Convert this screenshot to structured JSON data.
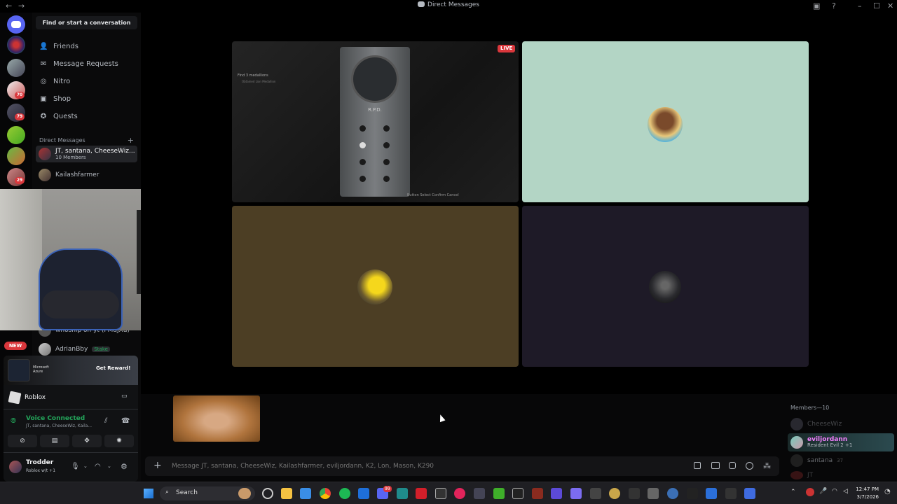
{
  "window": {
    "title": "Direct Messages"
  },
  "sidebar": {
    "search_label": "Find or start a conversation",
    "nav": [
      {
        "label": "Friends",
        "icon": "friends-icon"
      },
      {
        "label": "Message Requests",
        "icon": "mail-icon"
      },
      {
        "label": "Nitro",
        "icon": "nitro-icon"
      },
      {
        "label": "Shop",
        "icon": "shop-icon"
      },
      {
        "label": "Quests",
        "icon": "quests-icon"
      }
    ],
    "dm_header": "Direct Messages",
    "dms": [
      {
        "name": "JT, santana, CheeseWiz...",
        "sub": "10 Members"
      },
      {
        "name": "Kailashfarmer",
        "sub": ""
      },
      {
        "name": "whoship on yt (FMdJXu)",
        "sub": ""
      },
      {
        "name": "AdrianBby",
        "sub": "",
        "tag": "Stake"
      }
    ]
  },
  "rail": {
    "new_badge": "NEW",
    "badges": [
      "70",
      "79",
      "29"
    ]
  },
  "promo": {
    "brands": "Microsoft Azure",
    "button": "Get Reward!"
  },
  "activity": {
    "game": "Roblox"
  },
  "voice": {
    "status": "Voice Connected",
    "channel": "JT, santana, CheeseWiz, Kaila..."
  },
  "user": {
    "name": "Trodder",
    "status": "Roblox w/t +1"
  },
  "stage": {
    "live_badge": "LIVE",
    "game_overlay": {
      "objective": "Find 3 medallions",
      "sub": "Obtained Lion Medallion",
      "prompts": "Button Select   Confirm   Cancel",
      "device_label": "R.P.D."
    }
  },
  "chat": {
    "placeholder": "Message JT, santana, CheeseWiz, Kailashfarmer, eviljordann, K2, Lon, Mason, K290"
  },
  "members": {
    "header": "Members—10",
    "list": [
      {
        "name": "CheeseWiz",
        "status": "",
        "dim": true
      },
      {
        "name": "eviljordann",
        "status": "Resident Evil 2 +1",
        "dim": false
      },
      {
        "name": "santana",
        "status": "",
        "tag": "37",
        "dim": true
      },
      {
        "name": "JT",
        "status": "",
        "dim": true
      }
    ]
  },
  "taskbar": {
    "search": "Search",
    "time": "12:47 PM",
    "date": "3/7/2026",
    "discord_badge": "99"
  },
  "colors": {
    "accent": "#5865f2",
    "online": "#23a55a",
    "live": "#da373c",
    "voice_green": "#23a55a",
    "tile_mint": "#b3d5c5",
    "tile_olive": "#4c3e24",
    "tile_purple": "#1e1a27"
  }
}
